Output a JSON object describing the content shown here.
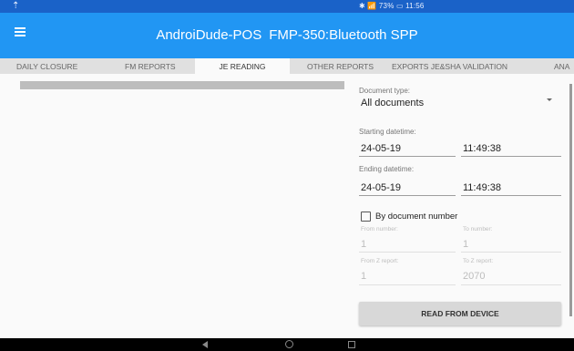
{
  "status_bar": {
    "left_icon": "upload-arrow-icon",
    "right_text": "✱ 📶 73% ▭ 11:56"
  },
  "app_bar": {
    "menu_icon": "hamburger-menu-icon",
    "title": "AndroiDude-POS",
    "subtitle": "FMP-350:Bluetooth SPP"
  },
  "tabs": [
    {
      "label": "DAILY CLOSURE"
    },
    {
      "label": "FM REPORTS"
    },
    {
      "label": "JE READING",
      "active": true
    },
    {
      "label": "OTHER REPORTS"
    },
    {
      "label": "EXPORTS JE&SHA VALIDATION"
    },
    {
      "label": "ANA"
    }
  ],
  "form": {
    "document_type_label": "Document type:",
    "document_type_value": "All documents",
    "starting_label": "Starting datetime:",
    "starting_date": "24-05-19",
    "starting_time": "11:49:38",
    "ending_label": "Ending datetime:",
    "ending_date": "24-05-19",
    "ending_time": "11:49:38",
    "by_document_number_label": "By document number",
    "from_number_label": "From number:",
    "from_number_value": "1",
    "to_number_label": "To number:",
    "to_number_value": "1",
    "from_z_label": "From Z report:",
    "from_z_value": "1",
    "to_z_label": "To Z report:",
    "to_z_value": "2070",
    "read_button": "READ FROM DEVICE"
  }
}
